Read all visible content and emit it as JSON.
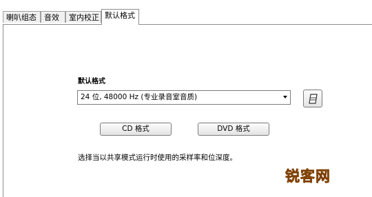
{
  "tabs": [
    {
      "label": "喇叭组态"
    },
    {
      "label": "音效"
    },
    {
      "label": "室内校正"
    },
    {
      "label": "默认格式",
      "active": true
    }
  ],
  "default_format": {
    "section_label": "默认格式",
    "selected_format": "24 位, 48000 Hz (专业录音室音质)",
    "cd_button": "CD 格式",
    "dvd_button": "DVD 格式",
    "description": "选择当以共享模式运行时使用的采样率和位深度。"
  },
  "watermark": "锐客网",
  "icons": {
    "restore_button": "eraser-icon"
  },
  "colors": {
    "watermark": "#f0932b",
    "border": "#8c8c8c"
  }
}
